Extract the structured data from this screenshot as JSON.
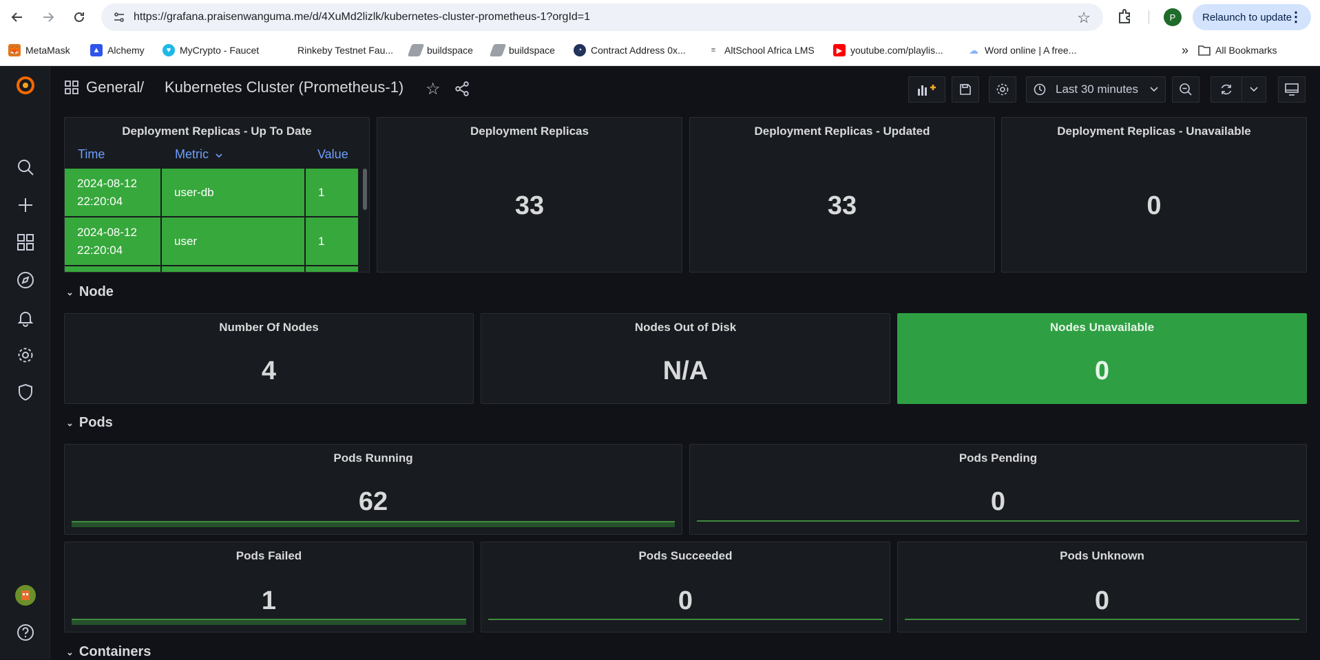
{
  "browser": {
    "url": "https://grafana.praisenwanguma.me/d/4XuMd2lizlk/kubernetes-cluster-prometheus-1?orgId=1",
    "profile_initial": "P",
    "relaunch_label": "Relaunch to update",
    "bookmarks": [
      {
        "label": "MetaMask",
        "icon": "metamask-icon",
        "color": "#e2761b"
      },
      {
        "label": "Alchemy",
        "icon": "alchemy-icon",
        "color": "#2f54eb"
      },
      {
        "label": "MyCrypto - Faucet",
        "icon": "mycrypto-icon",
        "color": "#1eb8e7"
      },
      {
        "label": "Rinkeby Testnet Fau...",
        "icon": "blank-icon",
        "color": "#ffffff"
      },
      {
        "label": "buildspace",
        "icon": "buildspace-icon",
        "color": "#9aa0a6"
      },
      {
        "label": "buildspace",
        "icon": "buildspace-icon",
        "color": "#9aa0a6"
      },
      {
        "label": "Contract Address 0x...",
        "icon": "etherscan-icon",
        "color": "#21325b"
      },
      {
        "label": "AltSchool Africa LMS",
        "icon": "altschool-icon",
        "color": "#555555"
      },
      {
        "label": "youtube.com/playlis...",
        "icon": "youtube-icon",
        "color": "#ff0000"
      },
      {
        "label": "Word online | A free...",
        "icon": "cloud-icon",
        "color": "#8ab4f8"
      }
    ],
    "all_bookmarks_label": "All Bookmarks"
  },
  "topbar": {
    "breadcrumb_folder": "General",
    "breadcrumb_separator": "/",
    "dashboard_title": "Kubernetes Cluster (Prometheus-1)",
    "time_range": "Last 30 minutes"
  },
  "deploy_table": {
    "title": "Deployment Replicas - Up To Date",
    "columns": [
      "Time",
      "Metric",
      "Value"
    ],
    "rows": [
      {
        "time": "2024-08-12 22:20:04",
        "metric": "user-db",
        "value": "1"
      },
      {
        "time": "2024-08-12 22:20:04",
        "metric": "user",
        "value": "1"
      }
    ]
  },
  "stats_top": [
    {
      "title": "Deployment Replicas",
      "value": "33"
    },
    {
      "title": "Deployment Replicas - Updated",
      "value": "33"
    },
    {
      "title": "Deployment Replicas - Unavailable",
      "value": "0"
    }
  ],
  "rows": {
    "node": "Node",
    "pods": "Pods",
    "containers": "Containers"
  },
  "node_stats": [
    {
      "title": "Number Of Nodes",
      "value": "4"
    },
    {
      "title": "Nodes Out of Disk",
      "value": "N/A"
    },
    {
      "title": "Nodes Unavailable",
      "value": "0",
      "bg": "#2ea043"
    }
  ],
  "pod_stats": [
    {
      "title": "Pods Running",
      "value": "62"
    },
    {
      "title": "Pods Pending",
      "value": "0"
    },
    {
      "title": "Pods Failed",
      "value": "1"
    },
    {
      "title": "Pods Succeeded",
      "value": "0"
    },
    {
      "title": "Pods Unknown",
      "value": "0"
    }
  ],
  "colors": {
    "accent_green": "#37a83c",
    "link_blue": "#6e9fff",
    "bg": "#111217",
    "panel": "#181b1f"
  }
}
